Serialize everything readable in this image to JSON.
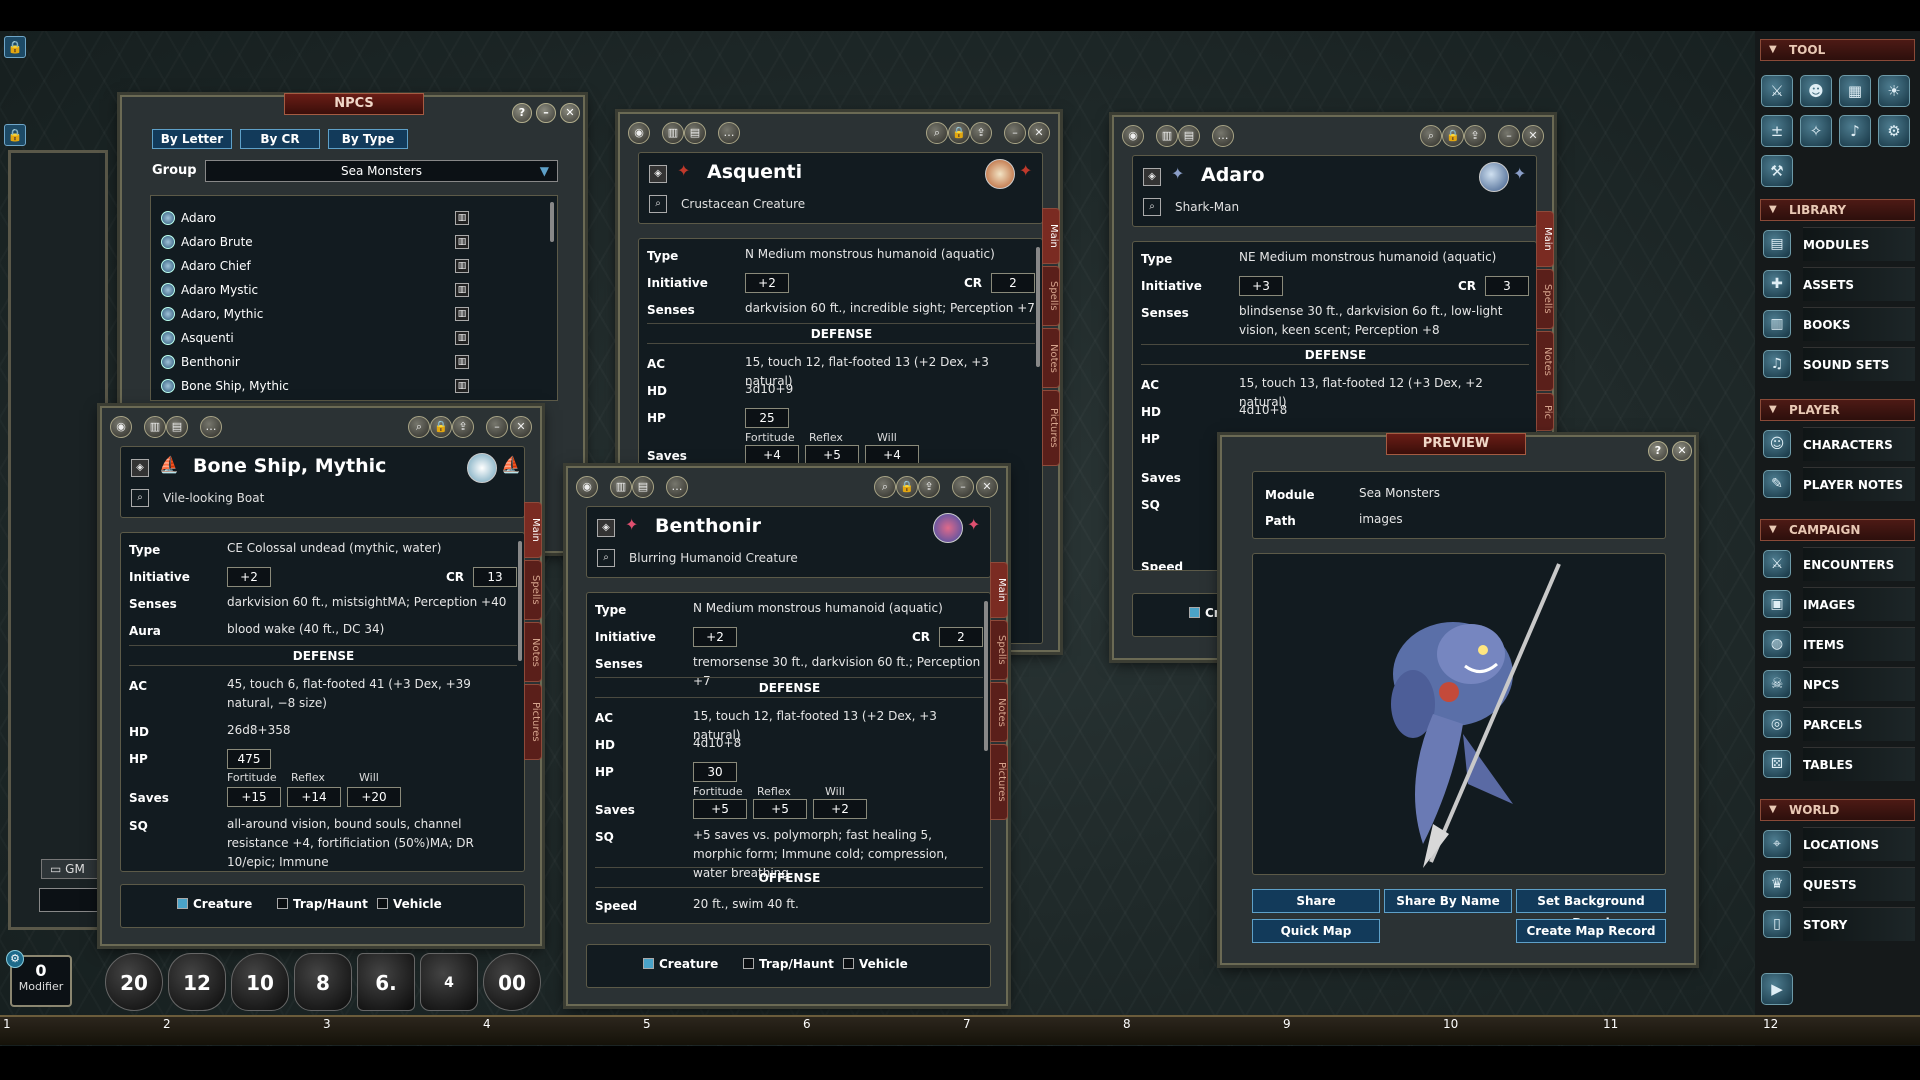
{
  "npcs_window": {
    "title": "NPCS",
    "filters": [
      "By Letter",
      "By CR",
      "By Type"
    ],
    "group_label": "Group",
    "group_value": "Sea Monsters",
    "items": [
      "Adaro",
      "Adaro Brute",
      "Adaro Chief",
      "Adaro Mystic",
      "Adaro, Mythic",
      "Asquenti",
      "Benthonir",
      "Bone Ship, Mythic"
    ]
  },
  "asquenti": {
    "name": "Asquenti",
    "subtitle": "Crustacean Creature",
    "type_label": "Type",
    "type": "N Medium monstrous humanoid (aquatic)",
    "init_label": "Initiative",
    "init": "+2",
    "cr_label": "CR",
    "cr": "2",
    "senses_label": "Senses",
    "senses": "darkvision 60 ft., incredible sight; Perception +7",
    "defense": "DEFENSE",
    "ac_label": "AC",
    "ac": "15, touch 12, flat-footed 13 (+2 Dex, +3 natural)",
    "hd_label": "HD",
    "hd": "3d10+9",
    "hp_label": "HP",
    "hp": "25",
    "fort_label": "Fortitude",
    "ref_label": "Reflex",
    "will_label": "Will",
    "saves_label": "Saves",
    "fort": "+4",
    "ref": "+5",
    "will": "+4",
    "tabs": [
      "Main",
      "Spells",
      "Notes",
      "Pictures"
    ]
  },
  "adaro": {
    "name": "Adaro",
    "subtitle": "Shark-Man",
    "type_label": "Type",
    "type": "NE Medium monstrous humanoid (aquatic)",
    "init_label": "Initiative",
    "init": "+3",
    "cr_label": "CR",
    "cr": "3",
    "senses_label": "Senses",
    "senses": "blindsense 30 ft., darkvision 6o ft., low-light vision, keen scent; Perception +8",
    "defense": "DEFENSE",
    "ac_label": "AC",
    "ac": "15, touch 13, flat-footed 12 (+3 Dex, +2 natural)",
    "hd_label": "HD",
    "hd": "4d10+8",
    "hp_label": "HP",
    "saves_label": "Saves",
    "sq_label": "SQ",
    "speed_label": "Speed",
    "creature_label": "Cr",
    "tabs": [
      "Main",
      "Spells",
      "Notes",
      "Pic"
    ]
  },
  "boneship": {
    "name": "Bone Ship, Mythic",
    "subtitle": "Vile-looking Boat",
    "type_label": "Type",
    "type": "CE Colossal undead (mythic, water)",
    "init_label": "Initiative",
    "init": "+2",
    "cr_label": "CR",
    "cr": "13",
    "senses_label": "Senses",
    "senses": "darkvision 60 ft., mistsightMA; Perception +40",
    "aura_label": "Aura",
    "aura": "blood wake (40 ft., DC 34)",
    "defense": "DEFENSE",
    "ac_label": "AC",
    "ac": "45, touch 6, flat-footed 41 (+3 Dex, +39 natural, −8 size)",
    "hd_label": "HD",
    "hd": "26d8+358",
    "hp_label": "HP",
    "hp": "475",
    "fort_label": "Fortitude",
    "ref_label": "Reflex",
    "will_label": "Will",
    "saves_label": "Saves",
    "fort": "+15",
    "ref": "+14",
    "will": "+20",
    "sq_label": "SQ",
    "sq": "all-around vision, bound souls, channel resistance +4, fortificiation (50%)MA; DR 10/epic; Immune",
    "creature": "Creature",
    "trap": "Trap/Haunt",
    "vehicle": "Vehicle",
    "tabs": [
      "Main",
      "Spells",
      "Notes",
      "Pictures"
    ]
  },
  "benthonir": {
    "name": "Benthonir",
    "subtitle": "Blurring Humanoid Creature",
    "type_label": "Type",
    "type": "N Medium monstrous humanoid (aquatic)",
    "init_label": "Initiative",
    "init": "+2",
    "cr_label": "CR",
    "cr": "2",
    "senses_label": "Senses",
    "senses": "tremorsense 30 ft., darkvision 60 ft.; Perception +7",
    "defense": "DEFENSE",
    "ac_label": "AC",
    "ac": "15, touch 12, flat-footed 13 (+2 Dex, +3 natural)",
    "hd_label": "HD",
    "hd": "4d10+8",
    "hp_label": "HP",
    "hp": "30",
    "fort_label": "Fortitude",
    "ref_label": "Reflex",
    "will_label": "Will",
    "saves_label": "Saves",
    "fort": "+5",
    "ref": "+5",
    "will": "+2",
    "sq_label": "SQ",
    "sq": "+5 saves vs. polymorph; fast healing 5, morphic form; Immune cold; compression, water breathing",
    "offense": "OFFENSE",
    "speed_label": "Speed",
    "speed": "20 ft., swim 40 ft.",
    "creature": "Creature",
    "trap": "Trap/Haunt",
    "vehicle": "Vehicle",
    "tabs": [
      "Main",
      "Spells",
      "Notes",
      "Pictures"
    ]
  },
  "preview": {
    "title": "PREVIEW",
    "module_label": "Module",
    "module": "Sea Monsters",
    "path_label": "Path",
    "path": "images",
    "buttons": [
      "Share",
      "Share By Name",
      "Set Background Decal",
      "Quick Map",
      "Create Map Record"
    ]
  },
  "sidebar": {
    "tool": "TOOL",
    "library": "LIBRARY",
    "library_items": [
      "MODULES",
      "ASSETS",
      "BOOKS",
      "SOUND SETS"
    ],
    "player": "PLAYER",
    "player_items": [
      "CHARACTERS",
      "PLAYER NOTES"
    ],
    "campaign": "CAMPAIGN",
    "campaign_items": [
      "ENCOUNTERS",
      "IMAGES",
      "ITEMS",
      "NPCS",
      "PARCELS",
      "TABLES"
    ],
    "world": "WORLD",
    "world_items": [
      "LOCATIONS",
      "QUESTS",
      "STORY"
    ]
  },
  "dice": {
    "modifier_value": "0",
    "modifier_label": "Modifier",
    "d20": "20",
    "d12": "12",
    "d10": "10",
    "d8": "8",
    "d6": "6.",
    "d4": "4",
    "d100": "00"
  },
  "chat": {
    "gm_label": "GM"
  },
  "ruler": [
    "1",
    "2",
    "3",
    "4",
    "5",
    "6",
    "7",
    "8",
    "9",
    "10",
    "11",
    "12"
  ]
}
